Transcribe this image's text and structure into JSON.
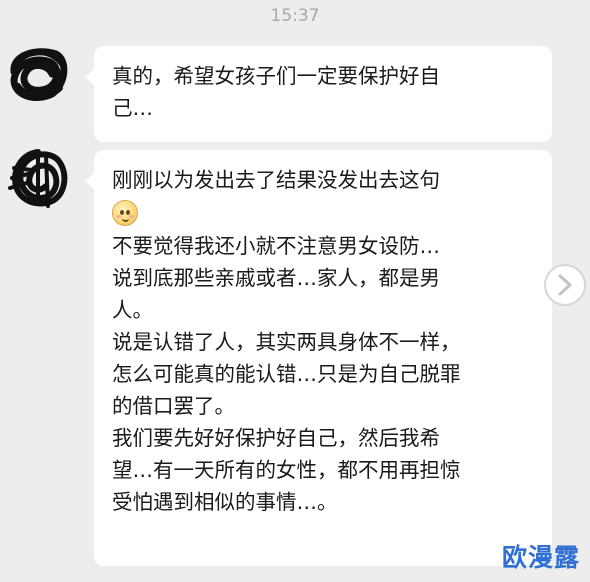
{
  "timestamp": "15:37",
  "messages": [
    {
      "avatar": "scribbled-avatar-icon",
      "lines": [
        "真的，希望女孩子们一定要保护好自",
        "己…"
      ]
    },
    {
      "avatar": "scribbled-avatar-icon",
      "lines_before_emoji": [
        "刚刚以为发出去了结果没发出去这句"
      ],
      "emoji": "blushing-smile-emoji-icon",
      "lines_after_emoji": [
        "不要觉得我还小就不注意男女设防…",
        "说到底那些亲戚或者…家人，都是男",
        "人。",
        "说是认错了人，其实两具身体不一样，",
        "怎么可能真的能认错…只是为自己脱罪",
        "的借口罢了。",
        "我们要先好好保护好自己，然后我希",
        "望…有一天所有的女性，都不用再担惊",
        "受怕遇到相似的事情…。"
      ]
    }
  ],
  "next_button_icon": "chevron-right-icon",
  "watermark": "欧漫露",
  "colors": {
    "background": "#ededed",
    "bubble": "#ffffff",
    "timestamp": "#a8a8a8",
    "watermark": "#2f6fd6"
  }
}
